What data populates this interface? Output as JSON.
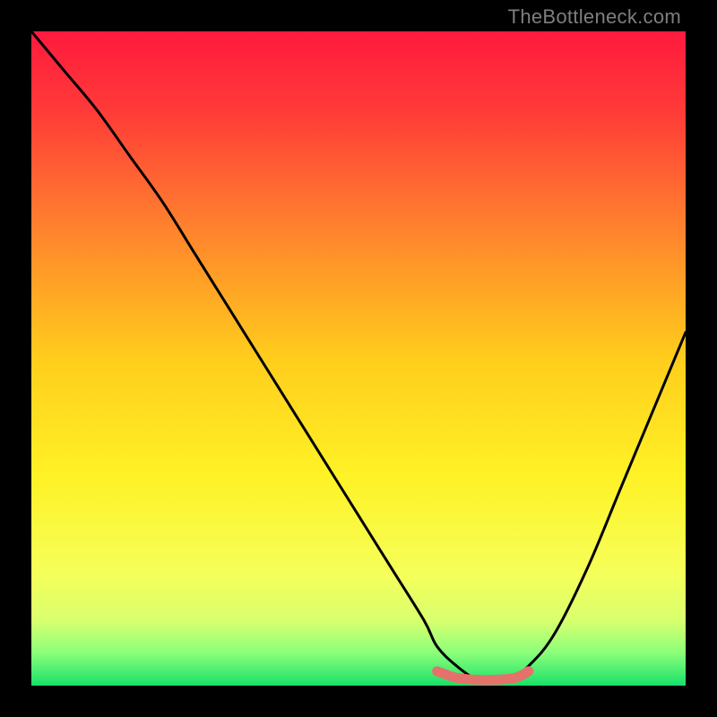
{
  "watermark": "TheBottleneck.com",
  "chart_data": {
    "type": "line",
    "title": "",
    "xlabel": "",
    "ylabel": "",
    "xlim": [
      0,
      100
    ],
    "ylim": [
      0,
      100
    ],
    "grid": false,
    "series": [
      {
        "name": "bottleneck-curve",
        "x": [
          0,
          5,
          10,
          15,
          20,
          25,
          30,
          35,
          40,
          45,
          50,
          55,
          60,
          62,
          65,
          68,
          70,
          73,
          76,
          80,
          85,
          90,
          95,
          100
        ],
        "values": [
          100,
          94,
          88,
          81,
          74,
          66,
          58,
          50,
          42,
          34,
          26,
          18,
          10,
          6,
          3,
          1,
          1,
          1,
          3,
          8,
          18,
          30,
          42,
          54
        ]
      },
      {
        "name": "highlight-band",
        "x": [
          62,
          65,
          68,
          71,
          74,
          76
        ],
        "values": [
          2.2,
          1.2,
          0.9,
          0.9,
          1.2,
          2.2
        ]
      }
    ],
    "gradient_stops": [
      {
        "pct": 0,
        "color": "#ff1a3e"
      },
      {
        "pct": 12,
        "color": "#ff3a38"
      },
      {
        "pct": 28,
        "color": "#ff7a2f"
      },
      {
        "pct": 50,
        "color": "#ffcd1c"
      },
      {
        "pct": 68,
        "color": "#fff226"
      },
      {
        "pct": 83,
        "color": "#f5ff5a"
      },
      {
        "pct": 90,
        "color": "#d9ff6e"
      },
      {
        "pct": 95,
        "color": "#8bff7a"
      },
      {
        "pct": 100,
        "color": "#18e06a"
      }
    ],
    "highlight_color": "#e5726a",
    "curve_color": "#000000"
  }
}
